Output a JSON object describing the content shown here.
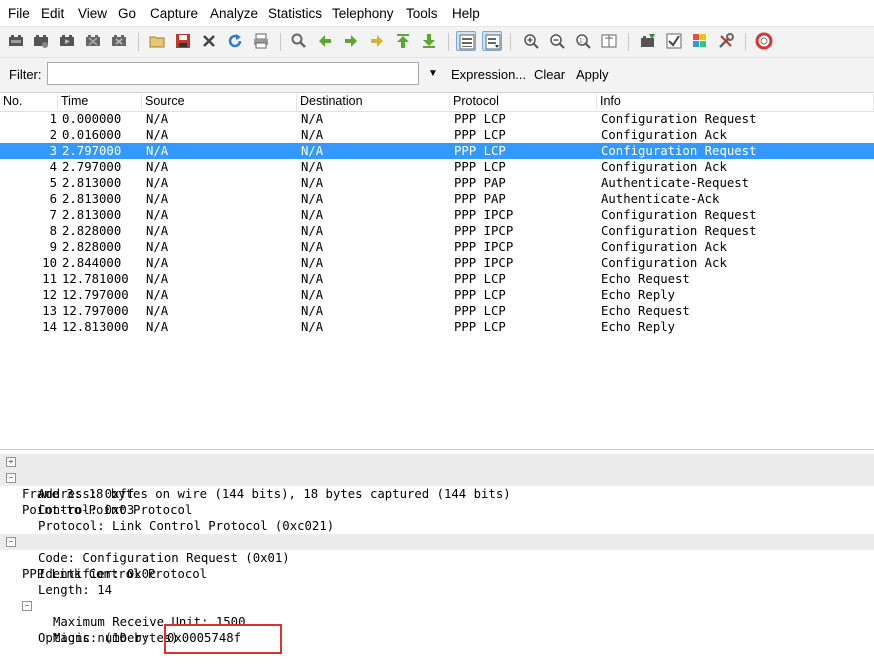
{
  "menu": [
    "File",
    "Edit",
    "View",
    "Go",
    "Capture",
    "Analyze",
    "Statistics",
    "Telephony",
    "Tools",
    "Help"
  ],
  "toolbar_icons": [
    "interface-list-icon",
    "capture-options-icon",
    "start-capture-icon",
    "stop-capture-icon",
    "restart-capture-icon",
    "open-file-icon",
    "save-file-icon",
    "close-file-icon",
    "reload-icon",
    "print-icon",
    "find-packet-icon",
    "go-back-icon",
    "go-forward-icon",
    "go-to-packet-icon",
    "go-first-icon",
    "go-last-icon",
    "colorize-icon",
    "auto-scroll-icon",
    "zoom-in-icon",
    "zoom-out-icon",
    "normal-size-icon",
    "resize-columns-icon",
    "capture-filters-icon",
    "display-filters-icon",
    "coloring-rules-icon",
    "preferences-icon",
    "help-icon"
  ],
  "filter": {
    "label": "Filter:",
    "value": "",
    "expression": "Expression...",
    "clear": "Clear",
    "apply": "Apply"
  },
  "columns": [
    "No.",
    "Time",
    "Source",
    "Destination",
    "Protocol",
    "Info"
  ],
  "packets": [
    {
      "no": "1",
      "time": "0.000000",
      "src": "N/A",
      "dst": "N/A",
      "proto": "PPP LCP",
      "info": "Configuration Request"
    },
    {
      "no": "2",
      "time": "0.016000",
      "src": "N/A",
      "dst": "N/A",
      "proto": "PPP LCP",
      "info": "Configuration Ack"
    },
    {
      "no": "3",
      "time": "2.797000",
      "src": "N/A",
      "dst": "N/A",
      "proto": "PPP LCP",
      "info": "Configuration Request"
    },
    {
      "no": "4",
      "time": "2.797000",
      "src": "N/A",
      "dst": "N/A",
      "proto": "PPP LCP",
      "info": "Configuration Ack"
    },
    {
      "no": "5",
      "time": "2.813000",
      "src": "N/A",
      "dst": "N/A",
      "proto": "PPP PAP",
      "info": "Authenticate-Request"
    },
    {
      "no": "6",
      "time": "2.813000",
      "src": "N/A",
      "dst": "N/A",
      "proto": "PPP PAP",
      "info": "Authenticate-Ack"
    },
    {
      "no": "7",
      "time": "2.813000",
      "src": "N/A",
      "dst": "N/A",
      "proto": "PPP IPCP",
      "info": "Configuration Request"
    },
    {
      "no": "8",
      "time": "2.828000",
      "src": "N/A",
      "dst": "N/A",
      "proto": "PPP IPCP",
      "info": "Configuration Request"
    },
    {
      "no": "9",
      "time": "2.828000",
      "src": "N/A",
      "dst": "N/A",
      "proto": "PPP IPCP",
      "info": "Configuration Ack"
    },
    {
      "no": "10",
      "time": "2.844000",
      "src": "N/A",
      "dst": "N/A",
      "proto": "PPP IPCP",
      "info": "Configuration Ack"
    },
    {
      "no": "11",
      "time": "12.781000",
      "src": "N/A",
      "dst": "N/A",
      "proto": "PPP LCP",
      "info": "Echo Request"
    },
    {
      "no": "12",
      "time": "12.797000",
      "src": "N/A",
      "dst": "N/A",
      "proto": "PPP LCP",
      "info": "Echo Reply"
    },
    {
      "no": "13",
      "time": "12.797000",
      "src": "N/A",
      "dst": "N/A",
      "proto": "PPP LCP",
      "info": "Echo Request"
    },
    {
      "no": "14",
      "time": "12.813000",
      "src": "N/A",
      "dst": "N/A",
      "proto": "PPP LCP",
      "info": "Echo Reply"
    }
  ],
  "selected_packet": "3",
  "details": {
    "frame": "Frame 3: 18 bytes on wire (144 bits), 18 bytes captured (144 bits)",
    "ppp": "Point-to-Point Protocol",
    "ppp_address": "Address: 0xff",
    "ppp_control": "Control: 0x03",
    "ppp_protocol": "Protocol: Link Control Protocol (0xc021)",
    "lcp": "PPP Link Control Protocol",
    "lcp_code": "Code: Configuration Request (0x01)",
    "lcp_identifier": "Identifier: 0x0c",
    "lcp_length": "Length: 14",
    "lcp_options": "Options: (10 bytes)",
    "opt_mru": "Maximum Receive Unit: 1500",
    "opt_magic_label": "Magic number: ",
    "opt_magic_value": "0x0005748f"
  },
  "colors": {
    "selection": "#3399ff",
    "highlight_box": "#e03030"
  }
}
